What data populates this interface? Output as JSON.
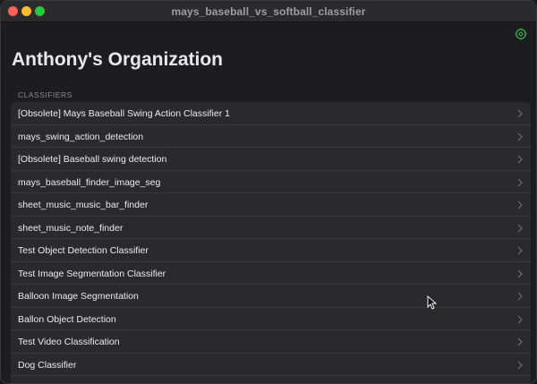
{
  "window": {
    "title": "mays_baseball_vs_softball_classifier"
  },
  "header": {
    "org_title": "Anthony's Organization",
    "settings_icon": "gear-icon"
  },
  "classifiers": {
    "section_label": "CLASSIFIERS",
    "items": [
      {
        "label": "[Obsolete] Mays Baseball Swing Action Classifier 1"
      },
      {
        "label": "mays_swing_action_detection"
      },
      {
        "label": "[Obsolete] Baseball swing detection"
      },
      {
        "label": "mays_baseball_finder_image_seg"
      },
      {
        "label": "sheet_music_music_bar_finder"
      },
      {
        "label": "sheet_music_note_finder"
      },
      {
        "label": "Test Object Detection Classifier"
      },
      {
        "label": "Test Image Segmentation Classifier"
      },
      {
        "label": "Balloon Image Segmentation"
      },
      {
        "label": "Ballon Object Detection"
      },
      {
        "label": "Test Video Classification"
      },
      {
        "label": "Dog Classifier"
      }
    ]
  },
  "colors": {
    "accent_green": "#3fae4a",
    "close": "#fe5f57",
    "minimize": "#febc2e",
    "maximize": "#28c840"
  }
}
